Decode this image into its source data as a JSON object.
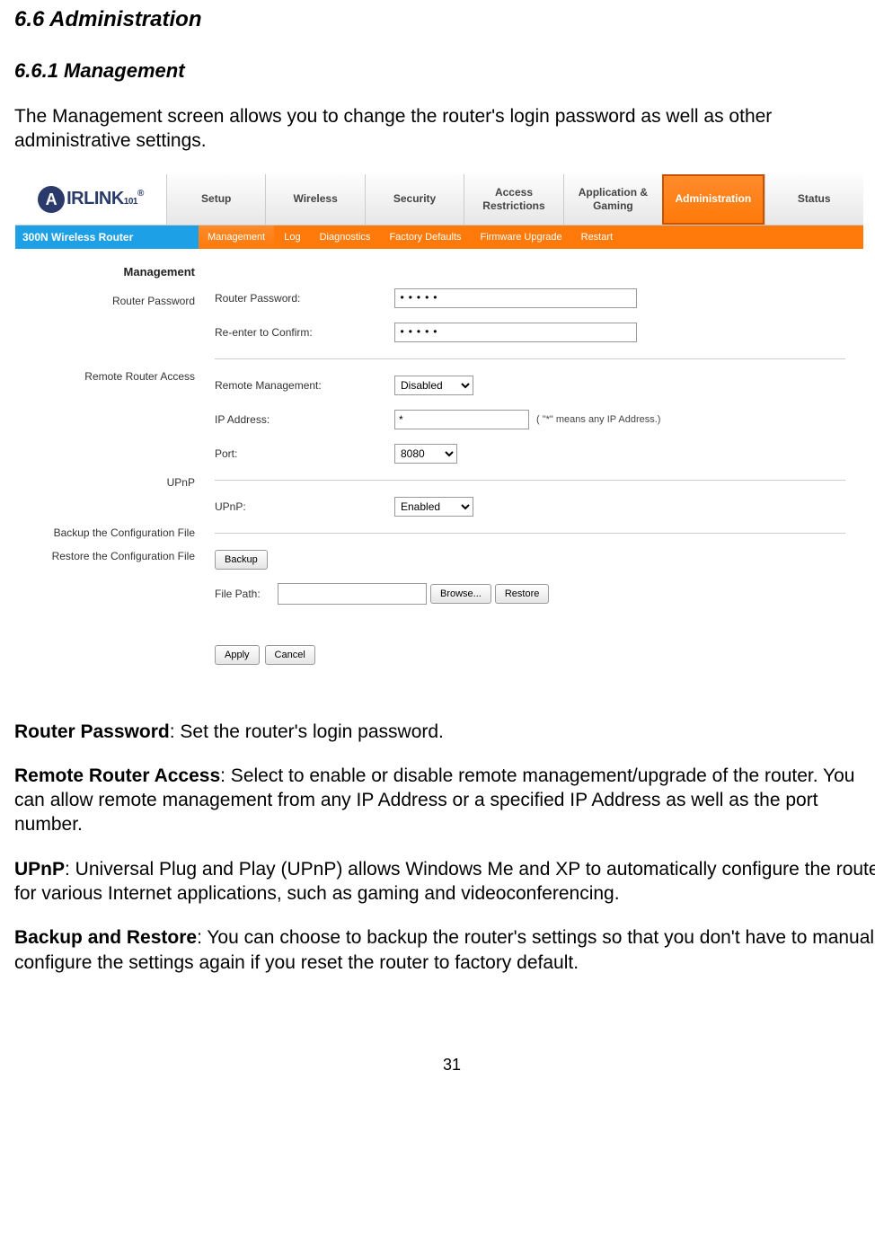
{
  "doc": {
    "h_section": "6.6 Administration",
    "h_sub": "6.6.1 Management",
    "intro": "The Management screen allows you to change the router's login password as well as other administrative settings.",
    "router_pw_head": "Router Password",
    "router_pw_body": ": Set the router's login password.",
    "remote_head": "Remote Router Access",
    "remote_body": ": Select to enable or disable remote management/upgrade of the router. You can allow remote management from any IP Address or a specified IP Address as well as the port number.",
    "upnp_head": "UPnP",
    "upnp_body": ": Universal Plug and Play (UPnP) allows Windows Me and XP to automatically configure the router for various Internet applications, such as gaming and videoconferencing.",
    "backup_head": "Backup and Restore",
    "backup_body": ": You can choose to backup the router's settings so that you don't have to manually configure the settings again if you reset the router to factory default.",
    "page_number": "31"
  },
  "ui": {
    "logo_text": "IRLINK",
    "logo_sub": "101",
    "logo_reg": "®",
    "model": "300N Wireless Router",
    "tabs": [
      "Setup",
      "Wireless",
      "Security",
      "Access Restrictions",
      "Application & Gaming",
      "Administration",
      "Status"
    ],
    "subtabs": [
      "Management",
      "Log",
      "Diagnostics",
      "Factory Defaults",
      "Firmware Upgrade",
      "Restart"
    ],
    "side": {
      "section": "Management",
      "router_pw": "Router Password",
      "remote": "Remote Router Access",
      "upnp": "UPnP",
      "backup": "Backup the Configuration File",
      "restore": "Restore the Configuration File"
    },
    "fields": {
      "router_pw_label": "Router Password:",
      "router_pw_value": "•••••",
      "reenter_label": "Re-enter to Confirm:",
      "reenter_value": "•••••",
      "remote_mgmt_label": "Remote Management:",
      "remote_mgmt_value": "Disabled",
      "ip_label": "IP Address:",
      "ip_value": "*",
      "ip_note": "( \"*\" means any IP Address.)",
      "port_label": "Port:",
      "port_value": "8080",
      "upnp_label": "UPnP:",
      "upnp_value": "Enabled",
      "file_path_label": "File Path:",
      "file_path_value": ""
    },
    "buttons": {
      "backup": "Backup",
      "browse": "Browse...",
      "restore": "Restore",
      "apply": "Apply",
      "cancel": "Cancel"
    }
  }
}
